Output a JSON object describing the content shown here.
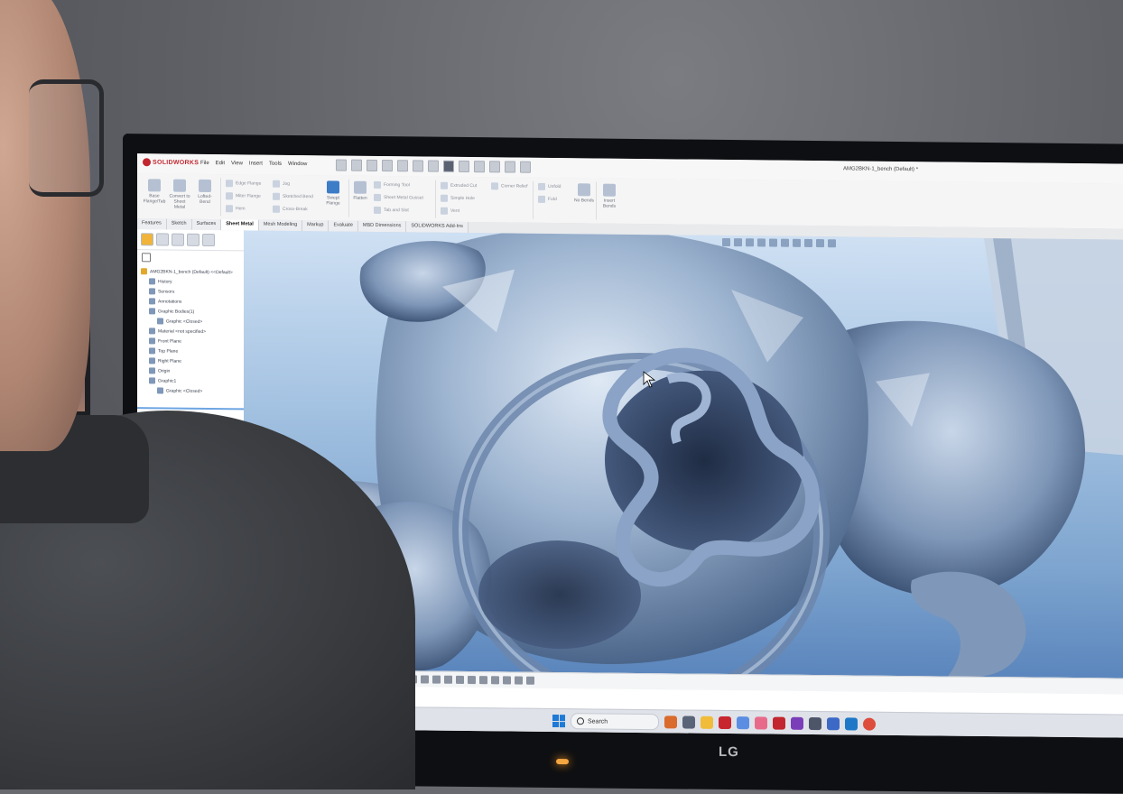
{
  "app": {
    "brand": "SOLIDWORKS",
    "menu": [
      "File",
      "Edit",
      "View",
      "Insert",
      "Tools",
      "Window"
    ],
    "document_title": "AMG2BKN-1_bench (Default) *"
  },
  "ribbon": {
    "buttons": [
      {
        "label": "Base Flange/Tab",
        "icon": "base-flange-icon"
      },
      {
        "label": "Convert to Sheet Metal",
        "icon": "convert-sheet-metal-icon"
      },
      {
        "label": "Lofted-Bend",
        "icon": "lofted-bend-icon"
      },
      {
        "label": "Swept Flange",
        "icon": "swept-flange-icon"
      },
      {
        "label": "Flatten",
        "icon": "flatten-icon"
      },
      {
        "label": "No Bends",
        "icon": "no-bends-icon"
      },
      {
        "label": "Insert Bends",
        "icon": "insert-bends-icon"
      }
    ],
    "small_buttons": [
      "Edge Flange",
      "Jog",
      "Miter Flange",
      "Sketched Bend",
      "Hem",
      "Cross-Break",
      "Forming Tool",
      "Sheet Metal Gusset",
      "Tab and Slot",
      "Extruded Cut",
      "Simple Hole",
      "Vent",
      "Corner Relief",
      "Unfold",
      "Fold"
    ]
  },
  "cm_tabs": [
    "Features",
    "Sketch",
    "Surfaces",
    "Sheet Metal",
    "Mesh Modeling",
    "Markup",
    "Evaluate",
    "MBD Dimensions",
    "SOLIDWORKS Add-Ins"
  ],
  "cm_active": "Sheet Metal",
  "feature_tree": {
    "root": "AMG2BKN-1_bench (Default) <<Default>",
    "items": [
      {
        "label": "History",
        "level": 1
      },
      {
        "label": "Sensors",
        "level": 1
      },
      {
        "label": "Annotations",
        "level": 1
      },
      {
        "label": "Graphic Bodies(1)",
        "level": 1
      },
      {
        "label": "Graphic <Closed>",
        "level": 2
      },
      {
        "label": "Material <not specified>",
        "level": 1
      },
      {
        "label": "Front Plane",
        "level": 1
      },
      {
        "label": "Top Plane",
        "level": 1
      },
      {
        "label": "Right Plane",
        "level": 1
      },
      {
        "label": "Origin",
        "level": 1
      },
      {
        "label": "Graphic1",
        "level": 1
      },
      {
        "label": "Graphic <Closed>",
        "level": 2
      }
    ]
  },
  "taskbar": {
    "search_placeholder": "Search",
    "apps": [
      {
        "icon": "widgets-icon",
        "color": "#d96b2c"
      },
      {
        "icon": "task-view-icon",
        "color": "#5a6478"
      },
      {
        "icon": "file-explorer-icon",
        "color": "#f0bc3a"
      },
      {
        "icon": "l-app-icon",
        "color": "#c8262e"
      },
      {
        "icon": "copilot-icon",
        "color": "#5b8de3"
      },
      {
        "icon": "photos-icon",
        "color": "#e86a8a"
      },
      {
        "icon": "solidworks-icon",
        "color": "#c2262e"
      },
      {
        "icon": "onenote-icon",
        "color": "#7a3fb8"
      },
      {
        "icon": "snipping-tool-icon",
        "color": "#4c5668"
      },
      {
        "icon": "teams-icon",
        "color": "#3d69c6"
      },
      {
        "icon": "outlook-icon",
        "color": "#1e78c8"
      },
      {
        "icon": "chrome-icon",
        "color": "#de4c3b"
      }
    ]
  },
  "monitor": {
    "brand": "LG"
  },
  "colors": {
    "accent": "#c2262e",
    "viewport_top": "#cfe0f3",
    "viewport_bottom": "#5b86bd",
    "mesh": "#8fa9c8"
  }
}
